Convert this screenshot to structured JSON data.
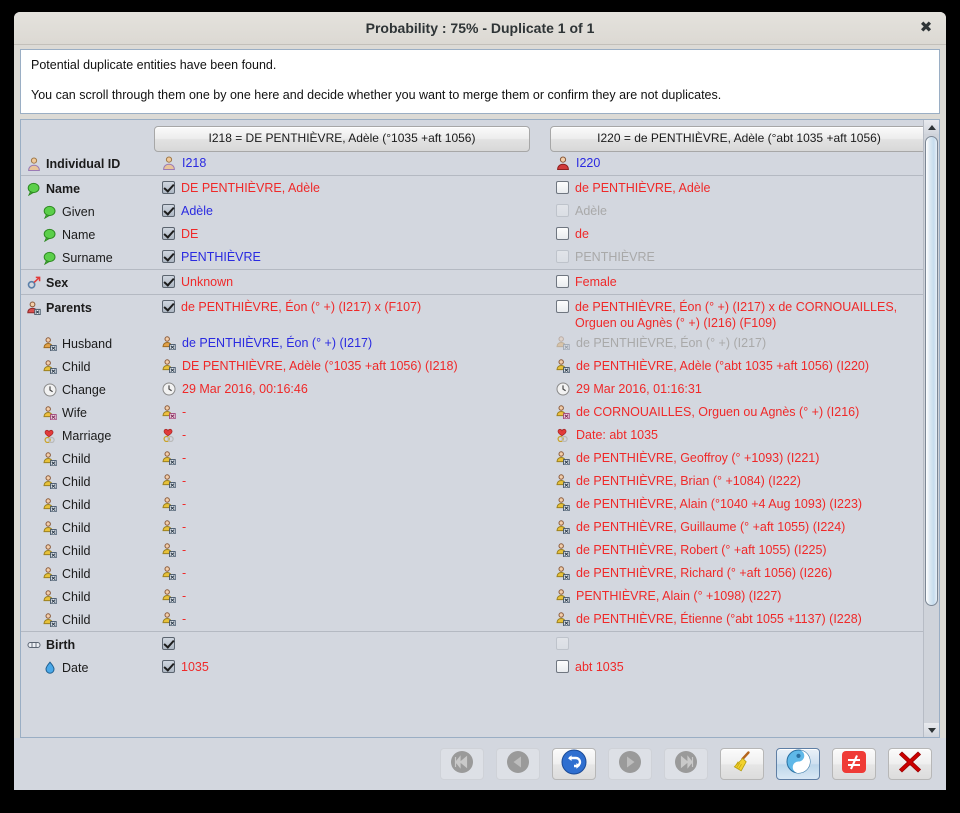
{
  "window": {
    "title": "Probability : 75% - Duplicate 1 of 1",
    "close_label": "✖"
  },
  "banner": {
    "line1": "Potential duplicate entities have been found.",
    "line2": "You can scroll through them one by one here and decide whether you want to merge them or confirm they are not duplicates."
  },
  "compare": {
    "header_a": "I218 = DE PENTHIÈVRE, Adèle (°1035 +aft 1056)",
    "header_b": "I220 = de PENTHIÈVRE, Adèle (°abt 1035 +aft 1056)",
    "rows": [
      {
        "type": "row",
        "label": "Individual ID",
        "icon": "person-icon",
        "bold": true,
        "indent": false,
        "a": {
          "check": "none",
          "icon": "person-icon",
          "text": "I218",
          "color": "blue"
        },
        "b": {
          "check": "none",
          "icon": "person-female-icon",
          "text": "I220",
          "color": "blue"
        }
      },
      {
        "type": "sep"
      },
      {
        "type": "row",
        "label": "Name",
        "icon": "tag-icon",
        "bold": true,
        "indent": false,
        "a": {
          "check": "checked",
          "text": "DE PENTHIÈVRE, Adèle",
          "color": "red"
        },
        "b": {
          "check": "unchecked",
          "text": "de PENTHIÈVRE, Adèle",
          "color": "red"
        }
      },
      {
        "type": "row",
        "label": "Given",
        "icon": "tag-icon",
        "bold": false,
        "indent": true,
        "a": {
          "check": "checked",
          "text": "Adèle",
          "color": "blue"
        },
        "b": {
          "check": "disabled",
          "text": "Adèle",
          "color": "gray"
        }
      },
      {
        "type": "row",
        "label": "Name",
        "icon": "tag-icon",
        "bold": false,
        "indent": true,
        "a": {
          "check": "checked",
          "text": "DE",
          "color": "red"
        },
        "b": {
          "check": "unchecked",
          "text": "de",
          "color": "red"
        }
      },
      {
        "type": "row",
        "label": "Surname",
        "icon": "tag-icon",
        "bold": false,
        "indent": true,
        "a": {
          "check": "checked",
          "text": "PENTHIÈVRE",
          "color": "blue"
        },
        "b": {
          "check": "disabled",
          "text": "PENTHIÈVRE",
          "color": "gray"
        }
      },
      {
        "type": "sep"
      },
      {
        "type": "row",
        "label": "Sex",
        "icon": "gender-icon",
        "bold": true,
        "indent": false,
        "a": {
          "check": "checked",
          "text": "Unknown",
          "color": "red"
        },
        "b": {
          "check": "unchecked",
          "text": "Female",
          "color": "red"
        }
      },
      {
        "type": "sep"
      },
      {
        "type": "row",
        "label": "Parents",
        "icon": "family-icon",
        "bold": true,
        "indent": false,
        "tall": true,
        "a": {
          "check": "checked",
          "text": "de PENTHIÈVRE, Éon (° +) (I217) x (F107)",
          "color": "red"
        },
        "b": {
          "check": "unchecked",
          "text": "de PENTHIÈVRE, Éon (° +) (I217) x de CORNOUAILLES, Orguen ou Agnès (° +) (I216) (F109)",
          "color": "red"
        }
      },
      {
        "type": "row",
        "label": "Husband",
        "icon": "man-icon",
        "bold": false,
        "indent": true,
        "a": {
          "check": "none",
          "icon": "man-icon",
          "text": "de PENTHIÈVRE, Éon (° +) (I217)",
          "color": "blue"
        },
        "b": {
          "check": "none",
          "icon": "man-icon",
          "dim": true,
          "text": "de PENTHIÈVRE, Éon (° +) (I217)",
          "color": "gray"
        }
      },
      {
        "type": "row",
        "label": "Child",
        "icon": "child-icon",
        "bold": false,
        "indent": true,
        "a": {
          "check": "none",
          "icon": "child-icon",
          "text": "DE PENTHIÈVRE, Adèle (°1035 +aft 1056) (I218)",
          "color": "red"
        },
        "b": {
          "check": "none",
          "icon": "child-icon",
          "text": "de PENTHIÈVRE, Adèle (°abt 1035 +aft 1056) (I220)",
          "color": "red"
        }
      },
      {
        "type": "row",
        "label": "Change",
        "icon": "clock-icon",
        "bold": false,
        "indent": true,
        "a": {
          "check": "none",
          "icon": "clock-icon",
          "text": "29 Mar 2016, 00:16:46",
          "color": "red"
        },
        "b": {
          "check": "none",
          "icon": "clock-icon",
          "text": "29 Mar 2016, 01:16:31",
          "color": "red"
        }
      },
      {
        "type": "row",
        "label": "Wife",
        "icon": "woman-icon",
        "bold": false,
        "indent": true,
        "a": {
          "check": "none",
          "icon": "woman-icon",
          "text": "-",
          "color": "red"
        },
        "b": {
          "check": "none",
          "icon": "woman-icon",
          "text": "de CORNOUAILLES, Orguen ou Agnès (° +) (I216)",
          "color": "red"
        }
      },
      {
        "type": "row",
        "label": "Marriage",
        "icon": "marriage-icon",
        "bold": false,
        "indent": true,
        "a": {
          "check": "none",
          "icon": "marriage-icon",
          "text": "-",
          "color": "red"
        },
        "b": {
          "check": "none",
          "icon": "marriage-icon",
          "text": "Date: abt 1035",
          "color": "red"
        }
      },
      {
        "type": "row",
        "label": "Child",
        "icon": "child-icon",
        "bold": false,
        "indent": true,
        "a": {
          "check": "none",
          "icon": "child-icon",
          "text": "-",
          "color": "red"
        },
        "b": {
          "check": "none",
          "icon": "child-icon",
          "text": "de PENTHIÈVRE, Geoffroy (° +1093) (I221)",
          "color": "red"
        }
      },
      {
        "type": "row",
        "label": "Child",
        "icon": "child-icon",
        "bold": false,
        "indent": true,
        "a": {
          "check": "none",
          "icon": "child-icon",
          "text": "-",
          "color": "red"
        },
        "b": {
          "check": "none",
          "icon": "child-icon",
          "text": "de PENTHIÈVRE, Brian (° +1084) (I222)",
          "color": "red"
        }
      },
      {
        "type": "row",
        "label": "Child",
        "icon": "child-icon",
        "bold": false,
        "indent": true,
        "a": {
          "check": "none",
          "icon": "child-icon",
          "text": "-",
          "color": "red"
        },
        "b": {
          "check": "none",
          "icon": "child-icon",
          "text": "de PENTHIÈVRE, Alain (°1040 +4 Aug 1093) (I223)",
          "color": "red"
        }
      },
      {
        "type": "row",
        "label": "Child",
        "icon": "child-icon",
        "bold": false,
        "indent": true,
        "a": {
          "check": "none",
          "icon": "child-icon",
          "text": "-",
          "color": "red"
        },
        "b": {
          "check": "none",
          "icon": "child-icon",
          "text": "de PENTHIÈVRE, Guillaume (° +aft 1055) (I224)",
          "color": "red"
        }
      },
      {
        "type": "row",
        "label": "Child",
        "icon": "child-icon",
        "bold": false,
        "indent": true,
        "a": {
          "check": "none",
          "icon": "child-icon",
          "text": "-",
          "color": "red"
        },
        "b": {
          "check": "none",
          "icon": "child-icon",
          "text": "de PENTHIÈVRE, Robert (° +aft 1055) (I225)",
          "color": "red"
        }
      },
      {
        "type": "row",
        "label": "Child",
        "icon": "child-icon",
        "bold": false,
        "indent": true,
        "a": {
          "check": "none",
          "icon": "child-icon",
          "text": "-",
          "color": "red"
        },
        "b": {
          "check": "none",
          "icon": "child-icon",
          "text": "de PENTHIÈVRE, Richard (° +aft 1056) (I226)",
          "color": "red"
        }
      },
      {
        "type": "row",
        "label": "Child",
        "icon": "child-icon",
        "bold": false,
        "indent": true,
        "a": {
          "check": "none",
          "icon": "child-icon",
          "text": "-",
          "color": "red"
        },
        "b": {
          "check": "none",
          "icon": "child-icon",
          "text": "PENTHIÈVRE, Alain (° +1098) (I227)",
          "color": "red"
        }
      },
      {
        "type": "row",
        "label": "Child",
        "icon": "child-icon",
        "bold": false,
        "indent": true,
        "a": {
          "check": "none",
          "icon": "child-icon",
          "text": "-",
          "color": "red"
        },
        "b": {
          "check": "none",
          "icon": "child-icon",
          "text": "de PENTHIÈVRE, Étienne (°abt 1055 +1137) (I228)",
          "color": "red"
        }
      },
      {
        "type": "sep"
      },
      {
        "type": "row",
        "label": "Birth",
        "icon": "birth-icon",
        "bold": true,
        "indent": false,
        "a": {
          "check": "checked",
          "text": "",
          "color": "red"
        },
        "b": {
          "check": "disabled",
          "text": "",
          "color": "red"
        }
      },
      {
        "type": "row",
        "label": "Date",
        "icon": "date-icon",
        "bold": false,
        "indent": true,
        "a": {
          "check": "checked",
          "text": "1035",
          "color": "red"
        },
        "b": {
          "check": "unchecked",
          "text": "abt 1035",
          "color": "red"
        }
      }
    ]
  },
  "toolbar": {
    "buttons": [
      {
        "name": "first-button",
        "icon": "skip-backward-icon",
        "state": "disabled"
      },
      {
        "name": "previous-button",
        "icon": "play-backward-icon",
        "state": "disabled"
      },
      {
        "name": "merge-swap-button",
        "icon": "swap-arrows-icon",
        "state": "normal"
      },
      {
        "name": "next-button",
        "icon": "play-forward-icon",
        "state": "disabled"
      },
      {
        "name": "last-button",
        "icon": "skip-forward-icon",
        "state": "disabled"
      },
      {
        "name": "clean-button",
        "icon": "broom-icon",
        "state": "normal"
      },
      {
        "name": "merge-button",
        "icon": "yin-yang-icon",
        "state": "active"
      },
      {
        "name": "not-duplicate-button",
        "icon": "not-equal-icon",
        "state": "normal"
      },
      {
        "name": "close-button",
        "icon": "red-cross-icon",
        "state": "normal"
      }
    ]
  },
  "colors": {
    "accent_red": "#ef2929",
    "accent_blue": "#2a2ae0",
    "disabled_gray": "#a9a9a9",
    "window_bg": "#dcdad5",
    "pane_bg": "#d3d7df"
  }
}
